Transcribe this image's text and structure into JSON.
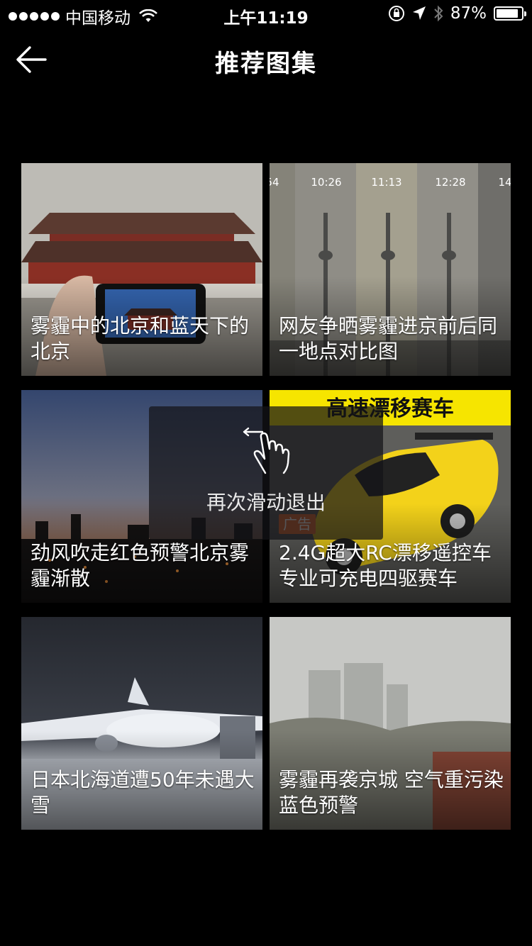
{
  "status_bar": {
    "carrier": "中国移动",
    "time": "上午11:19",
    "battery": "87%",
    "battery_level": 0.87
  },
  "nav": {
    "title": "推荐图集"
  },
  "tiles": [
    {
      "caption": "雾霾中的北京和蓝天下的北京",
      "photo": "forbidden-city-phone"
    },
    {
      "caption": "网友争晒雾霾进京前后同一地点对比图",
      "photo": "tower-time-lapse"
    },
    {
      "caption": "劲风吹走红色预警北京雾霾渐散",
      "photo": "dusk-skyline"
    },
    {
      "caption": "2.4G超大RC漂移遥控车 专业可充电四驱赛车",
      "photo": "yellow-rc-car",
      "banner": "高速漂移赛车"
    },
    {
      "caption": "日本北海道遭50年未遇大雪",
      "photo": "airplane-snow"
    },
    {
      "caption": "雾霾再袭京城 空气重污染蓝色预警",
      "photo": "hazy-city"
    }
  ],
  "time_labels": [
    "54",
    "10:26",
    "11:13",
    "12:28",
    "14"
  ],
  "ad_label": "广告",
  "hint": {
    "text": "再次滑动退出"
  }
}
